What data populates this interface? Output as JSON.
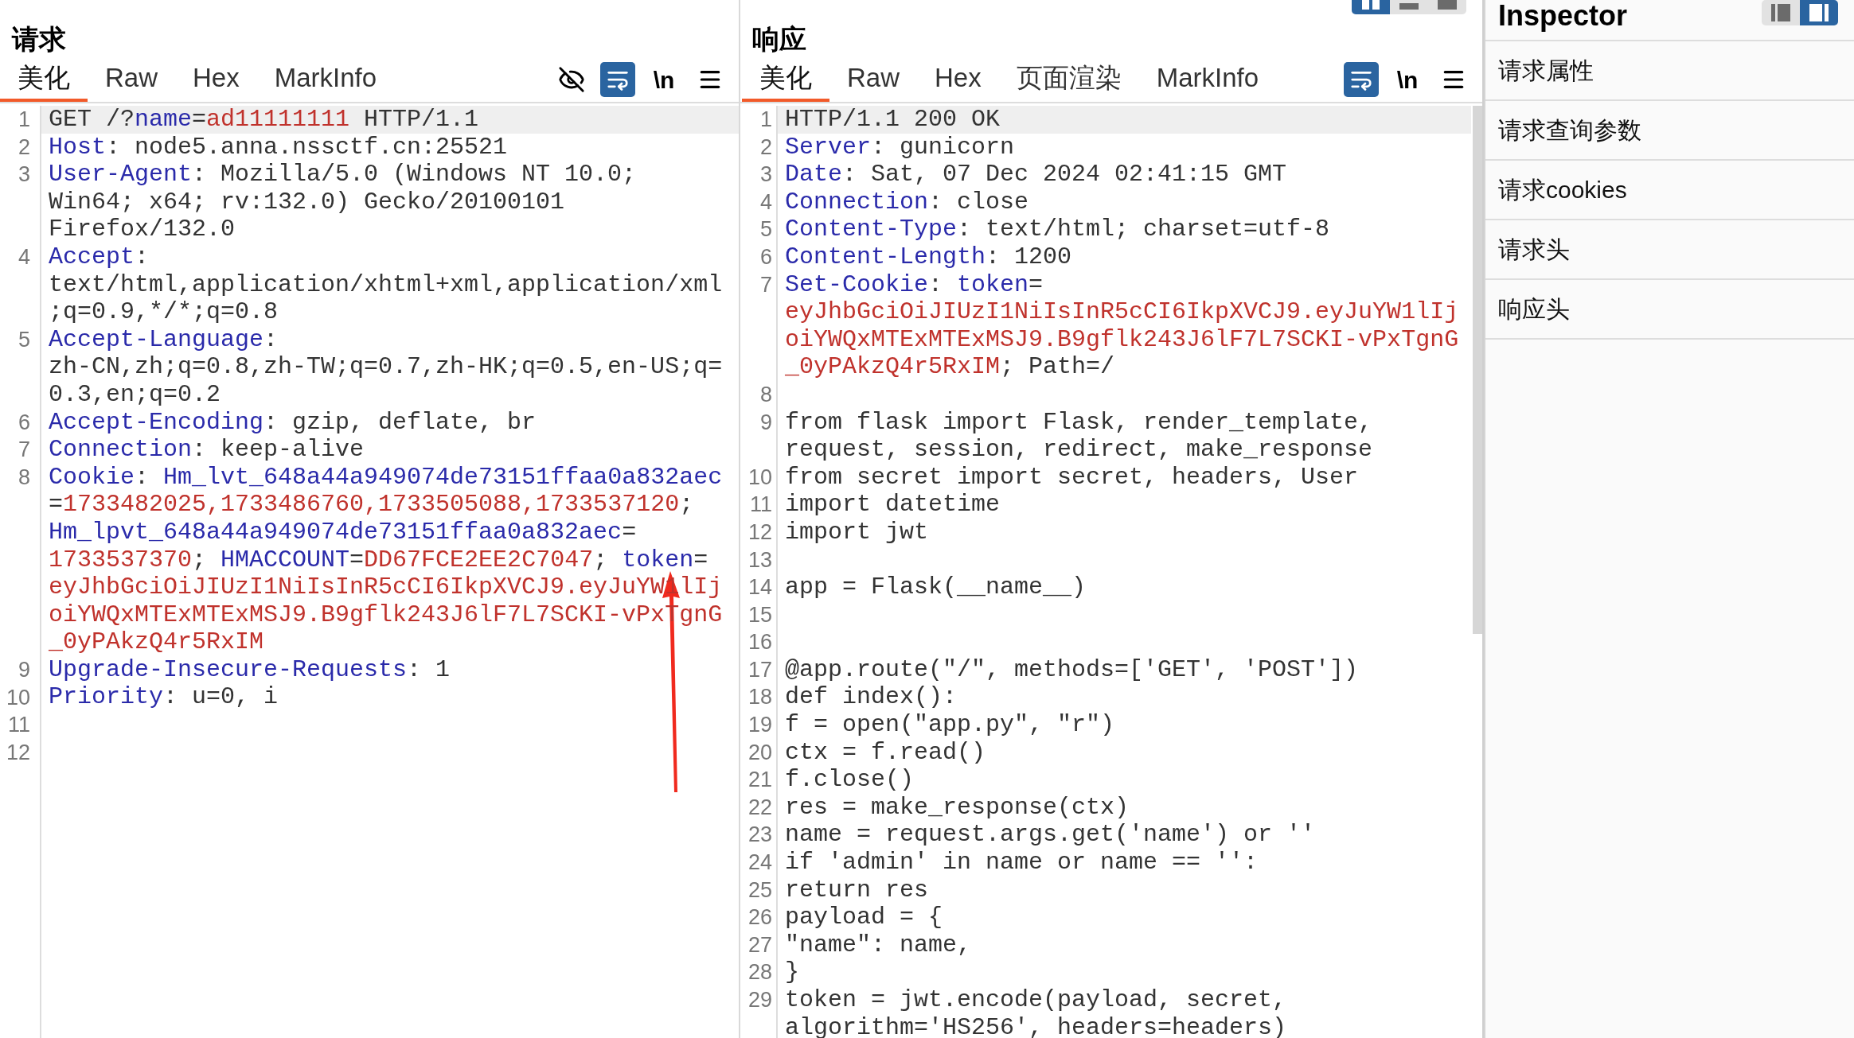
{
  "request": {
    "title": "请求",
    "tabs": [
      {
        "label": "美化",
        "selected": true
      },
      {
        "label": "Raw",
        "selected": false
      },
      {
        "label": "Hex",
        "selected": false
      },
      {
        "label": "MarkInfo",
        "selected": false
      }
    ],
    "toolbar": [
      {
        "kind": "hide"
      },
      {
        "kind": "wrap",
        "on": true
      },
      {
        "kind": "newline",
        "label": "\\n"
      },
      {
        "kind": "menu"
      }
    ],
    "lines": [
      {
        "number": "1",
        "current": true,
        "rows": [
          {
            "segments": [
              {
                "text": "GET /?",
                "kind": "plain"
              },
              {
                "text": "name",
                "kind": "key"
              },
              {
                "text": "=",
                "kind": "plain"
              },
              {
                "text": "ad11111111",
                "kind": "value"
              },
              {
                "text": " HTTP/1.1",
                "kind": "plain"
              }
            ]
          }
        ]
      },
      {
        "number": "2",
        "current": false,
        "rows": [
          {
            "segments": [
              {
                "text": "Host",
                "kind": "key"
              },
              {
                "text": ": node5.anna.nssctf.cn:25521",
                "kind": "plain"
              }
            ]
          }
        ]
      },
      {
        "number": "3",
        "current": false,
        "rows": [
          {
            "segments": [
              {
                "text": "User-Agent",
                "kind": "key"
              },
              {
                "text": ": Mozilla/5.0 (Windows NT 10.0;",
                "kind": "plain"
              }
            ]
          },
          {
            "segments": [
              {
                "text": "Win64; x64; rv:132.0) Gecko/20100101",
                "kind": "plain"
              }
            ]
          },
          {
            "segments": [
              {
                "text": "Firefox/132.0",
                "kind": "plain"
              }
            ]
          }
        ]
      },
      {
        "number": "4",
        "current": false,
        "rows": [
          {
            "segments": [
              {
                "text": "Accept",
                "kind": "key"
              },
              {
                "text": ":",
                "kind": "plain"
              }
            ]
          },
          {
            "segments": [
              {
                "text": "text/html,application/xhtml+xml,application/xml",
                "kind": "plain"
              }
            ]
          },
          {
            "segments": [
              {
                "text": ";q=0.9,*/*;q=0.8",
                "kind": "plain"
              }
            ]
          }
        ]
      },
      {
        "number": "5",
        "current": false,
        "rows": [
          {
            "segments": [
              {
                "text": "Accept-Language",
                "kind": "key"
              },
              {
                "text": ":",
                "kind": "plain"
              }
            ]
          },
          {
            "segments": [
              {
                "text": "zh-CN,zh;q=0.8,zh-TW;q=0.7,zh-HK;q=0.5,en-US;q=",
                "kind": "plain"
              }
            ]
          },
          {
            "segments": [
              {
                "text": "0.3,en;q=0.2",
                "kind": "plain"
              }
            ]
          }
        ]
      },
      {
        "number": "6",
        "current": false,
        "rows": [
          {
            "segments": [
              {
                "text": "Accept-Encoding",
                "kind": "key"
              },
              {
                "text": ": gzip, deflate, br",
                "kind": "plain"
              }
            ]
          }
        ]
      },
      {
        "number": "7",
        "current": false,
        "rows": [
          {
            "segments": [
              {
                "text": "Connection",
                "kind": "key"
              },
              {
                "text": ": keep-alive",
                "kind": "plain"
              }
            ]
          }
        ]
      },
      {
        "number": "8",
        "current": false,
        "rows": [
          {
            "segments": [
              {
                "text": "Cookie",
                "kind": "key"
              },
              {
                "text": ": ",
                "kind": "plain"
              },
              {
                "text": "Hm_lvt_648a44a949074de73151ffaa0a832aec",
                "kind": "key"
              }
            ]
          },
          {
            "segments": [
              {
                "text": "=",
                "kind": "plain"
              },
              {
                "text": "1733482025,1733486760,1733505088,1733537120",
                "kind": "value"
              },
              {
                "text": ";",
                "kind": "plain"
              }
            ]
          },
          {
            "segments": [
              {
                "text": "Hm_lpvt_648a44a949074de73151ffaa0a832aec",
                "kind": "key"
              },
              {
                "text": "=",
                "kind": "plain"
              }
            ]
          },
          {
            "segments": [
              {
                "text": "1733537370",
                "kind": "value"
              },
              {
                "text": "; ",
                "kind": "plain"
              },
              {
                "text": "HMACCOUNT",
                "kind": "key"
              },
              {
                "text": "=",
                "kind": "plain"
              },
              {
                "text": "DD67FCE2EE2C7047",
                "kind": "value"
              },
              {
                "text": "; ",
                "kind": "plain"
              },
              {
                "text": "token",
                "kind": "key"
              },
              {
                "text": "=",
                "kind": "plain"
              }
            ]
          },
          {
            "segments": [
              {
                "text": "eyJhbGciOiJIUzI1NiIsInR5cCI6IkpXVCJ9.eyJuYW1lIj",
                "kind": "value"
              }
            ]
          },
          {
            "segments": [
              {
                "text": "oiYWQxMTExMTExMSJ9.B9gflk243J6lF7L7SCKI-vPxTgnG",
                "kind": "value"
              }
            ]
          },
          {
            "segments": [
              {
                "text": "_0yPAkzQ4r5RxIM",
                "kind": "value"
              }
            ]
          }
        ]
      },
      {
        "number": "9",
        "current": false,
        "rows": [
          {
            "segments": [
              {
                "text": "Upgrade-Insecure-Requests",
                "kind": "key"
              },
              {
                "text": ": 1",
                "kind": "plain"
              }
            ]
          }
        ]
      },
      {
        "number": "10",
        "current": false,
        "rows": [
          {
            "segments": [
              {
                "text": "Priority",
                "kind": "key"
              },
              {
                "text": ": u=0, i",
                "kind": "plain"
              }
            ]
          }
        ]
      },
      {
        "number": "11",
        "current": false
      },
      {
        "number": "12",
        "current": false
      }
    ]
  },
  "response": {
    "title": "响应",
    "layout_buttons": [
      {
        "kind": "columns",
        "selected": true
      },
      {
        "kind": "rows",
        "selected": false
      },
      {
        "kind": "single",
        "selected": false
      }
    ],
    "tabs": [
      {
        "label": "美化",
        "selected": true
      },
      {
        "label": "Raw",
        "selected": false
      },
      {
        "label": "Hex",
        "selected": false
      },
      {
        "label": "页面渲染",
        "selected": false
      },
      {
        "label": "MarkInfo",
        "selected": false
      }
    ],
    "toolbar": [
      {
        "kind": "wrap",
        "on": true
      },
      {
        "kind": "newline",
        "label": "\\n"
      },
      {
        "kind": "menu"
      }
    ],
    "lines": [
      {
        "number": "1",
        "current": true,
        "rows": [
          {
            "segments": [
              {
                "text": "HTTP/1.1 200 OK",
                "kind": "plain"
              }
            ]
          }
        ]
      },
      {
        "number": "2",
        "current": false,
        "rows": [
          {
            "segments": [
              {
                "text": "Server",
                "kind": "key"
              },
              {
                "text": ": gunicorn",
                "kind": "plain"
              }
            ]
          }
        ]
      },
      {
        "number": "3",
        "current": false,
        "rows": [
          {
            "segments": [
              {
                "text": "Date",
                "kind": "key"
              },
              {
                "text": ": Sat, 07 Dec 2024 02:41:15 GMT",
                "kind": "plain"
              }
            ]
          }
        ]
      },
      {
        "number": "4",
        "current": false,
        "rows": [
          {
            "segments": [
              {
                "text": "Connection",
                "kind": "key"
              },
              {
                "text": ": close",
                "kind": "plain"
              }
            ]
          }
        ]
      },
      {
        "number": "5",
        "current": false,
        "rows": [
          {
            "segments": [
              {
                "text": "Content-Type",
                "kind": "key"
              },
              {
                "text": ": text/html; charset=utf-8",
                "kind": "plain"
              }
            ]
          }
        ]
      },
      {
        "number": "6",
        "current": false,
        "rows": [
          {
            "segments": [
              {
                "text": "Content-Length",
                "kind": "key"
              },
              {
                "text": ": 1200",
                "kind": "plain"
              }
            ]
          }
        ]
      },
      {
        "number": "7",
        "current": false,
        "rows": [
          {
            "segments": [
              {
                "text": "Set-Cookie",
                "kind": "key"
              },
              {
                "text": ": ",
                "kind": "plain"
              },
              {
                "text": "token",
                "kind": "key"
              },
              {
                "text": "=",
                "kind": "plain"
              }
            ]
          },
          {
            "segments": [
              {
                "text": "eyJhbGciOiJIUzI1NiIsInR5cCI6IkpXVCJ9.eyJuYW1lIj",
                "kind": "value"
              }
            ]
          },
          {
            "segments": [
              {
                "text": "oiYWQxMTExMTExMSJ9.B9gflk243J6lF7L7SCKI-vPxTgnG",
                "kind": "value"
              }
            ]
          },
          {
            "segments": [
              {
                "text": "_0yPAkzQ4r5RxIM",
                "kind": "value"
              },
              {
                "text": "; Path=/",
                "kind": "plain"
              }
            ]
          }
        ]
      },
      {
        "number": "8",
        "current": false
      },
      {
        "number": "9",
        "current": false,
        "rows": [
          {
            "segments": [
              {
                "text": "from flask import Flask, render_template,",
                "kind": "plain"
              }
            ]
          },
          {
            "segments": [
              {
                "text": "request, session, redirect, make_response",
                "kind": "plain"
              }
            ]
          }
        ]
      },
      {
        "number": "10",
        "current": false,
        "rows": [
          {
            "segments": [
              {
                "text": "from secret import secret, headers, User",
                "kind": "plain"
              }
            ]
          }
        ]
      },
      {
        "number": "11",
        "current": false,
        "rows": [
          {
            "segments": [
              {
                "text": "import datetime",
                "kind": "plain"
              }
            ]
          }
        ]
      },
      {
        "number": "12",
        "current": false,
        "rows": [
          {
            "segments": [
              {
                "text": "import jwt",
                "kind": "plain"
              }
            ]
          }
        ]
      },
      {
        "number": "13",
        "current": false
      },
      {
        "number": "14",
        "current": false,
        "rows": [
          {
            "segments": [
              {
                "text": "app = Flask(__name__)",
                "kind": "plain"
              }
            ]
          }
        ]
      },
      {
        "number": "15",
        "current": false
      },
      {
        "number": "16",
        "current": false
      },
      {
        "number": "17",
        "current": false,
        "rows": [
          {
            "segments": [
              {
                "text": "@app.route(\"/\", methods=['GET', 'POST'])",
                "kind": "plain"
              }
            ]
          }
        ]
      },
      {
        "number": "18",
        "current": false,
        "rows": [
          {
            "segments": [
              {
                "text": "def index():",
                "kind": "plain"
              }
            ]
          }
        ]
      },
      {
        "number": "19",
        "current": false,
        "rows": [
          {
            "segments": [
              {
                "text": "f = open(\"app.py\", \"r\")",
                "kind": "plain"
              }
            ]
          }
        ]
      },
      {
        "number": "20",
        "current": false,
        "rows": [
          {
            "segments": [
              {
                "text": "ctx = f.read()",
                "kind": "plain"
              }
            ]
          }
        ]
      },
      {
        "number": "21",
        "current": false,
        "rows": [
          {
            "segments": [
              {
                "text": "f.close()",
                "kind": "plain"
              }
            ]
          }
        ]
      },
      {
        "number": "22",
        "current": false,
        "rows": [
          {
            "segments": [
              {
                "text": "res = make_response(ctx)",
                "kind": "plain"
              }
            ]
          }
        ]
      },
      {
        "number": "23",
        "current": false,
        "rows": [
          {
            "segments": [
              {
                "text": "name = request.args.get('name') or ''",
                "kind": "plain"
              }
            ]
          }
        ]
      },
      {
        "number": "24",
        "current": false,
        "rows": [
          {
            "segments": [
              {
                "text": "if 'admin' in name or name == '':",
                "kind": "plain"
              }
            ]
          }
        ]
      },
      {
        "number": "25",
        "current": false,
        "rows": [
          {
            "segments": [
              {
                "text": "return res",
                "kind": "plain"
              }
            ]
          }
        ]
      },
      {
        "number": "26",
        "current": false,
        "rows": [
          {
            "segments": [
              {
                "text": "payload = {",
                "kind": "plain"
              }
            ]
          }
        ]
      },
      {
        "number": "27",
        "current": false,
        "rows": [
          {
            "segments": [
              {
                "text": "\"name\": name,",
                "kind": "plain"
              }
            ]
          }
        ]
      },
      {
        "number": "28",
        "current": false,
        "rows": [
          {
            "segments": [
              {
                "text": "}",
                "kind": "plain"
              }
            ]
          }
        ]
      },
      {
        "number": "29",
        "current": false,
        "rows": [
          {
            "segments": [
              {
                "text": "token = jwt.encode(payload, secret,",
                "kind": "plain"
              }
            ]
          },
          {
            "segments": [
              {
                "text": "algorithm='HS256', headers=headers)",
                "kind": "plain"
              }
            ]
          }
        ]
      }
    ]
  },
  "inspector": {
    "title": "Inspector",
    "view_buttons": [
      {
        "kind": "sidebar-left",
        "selected": false
      },
      {
        "kind": "sidebar-right",
        "selected": true
      }
    ],
    "sections": [
      "请求属性",
      "请求查询参数",
      "请求cookies",
      "请求头",
      "响应头"
    ]
  }
}
